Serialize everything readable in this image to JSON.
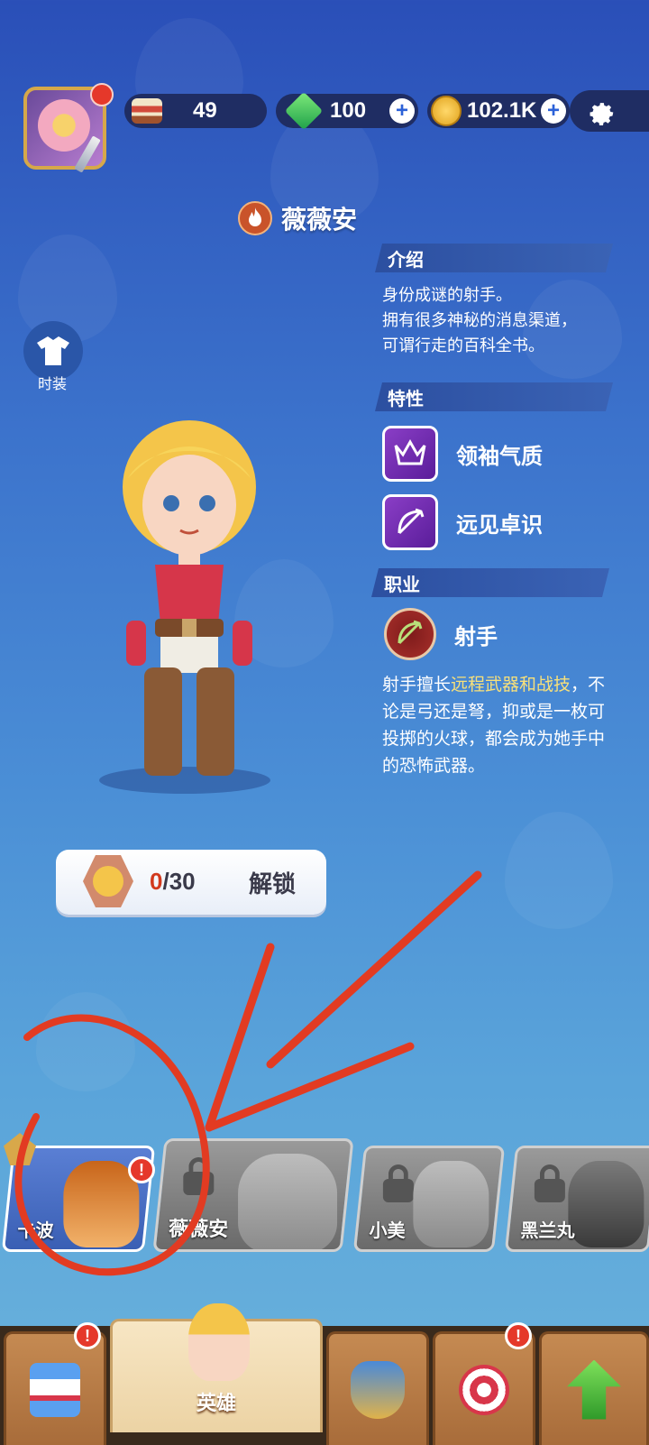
{
  "top_bar": {
    "cake_count": "49",
    "gem_count": "100",
    "coin_count": "102.1K"
  },
  "hero": {
    "name": "薇薇安",
    "wardrobe_label": "时装",
    "intro_title": "介绍",
    "intro_lines": [
      "身份成谜的射手。",
      "拥有很多神秘的消息渠道，",
      "可谓行走的百科全书。"
    ],
    "traits_title": "特性",
    "traits": [
      {
        "label": "领袖气质",
        "icon": "crown-icon"
      },
      {
        "label": "远见卓识",
        "icon": "bow-icon"
      }
    ],
    "class_title": "职业",
    "class_name": "射手",
    "class_desc_prefix": "射手擅长",
    "class_desc_highlight": "远程武器和战技",
    "class_desc_suffix": "，不论是弓还是弩，抑或是一枚可投掷的火球，都会成为她手中的恐怖武器。"
  },
  "unlock": {
    "current": "0",
    "total": "/30",
    "button_label": "解锁"
  },
  "hero_cards": [
    {
      "name": "卡波",
      "locked": false,
      "alert": "!"
    },
    {
      "name": "薇薇安",
      "locked": true
    },
    {
      "name": "小美",
      "locked": true
    },
    {
      "name": "黑兰丸",
      "locked": true
    }
  ],
  "bottom_nav": {
    "tabs": [
      {
        "icon": "shop-icon",
        "alert": "!"
      },
      {
        "icon": "hero-icon",
        "label": "英雄"
      },
      {
        "icon": "battle-icon"
      },
      {
        "icon": "archery-target-icon",
        "alert": "!"
      },
      {
        "icon": "upgrade-arrow-icon"
      }
    ]
  }
}
